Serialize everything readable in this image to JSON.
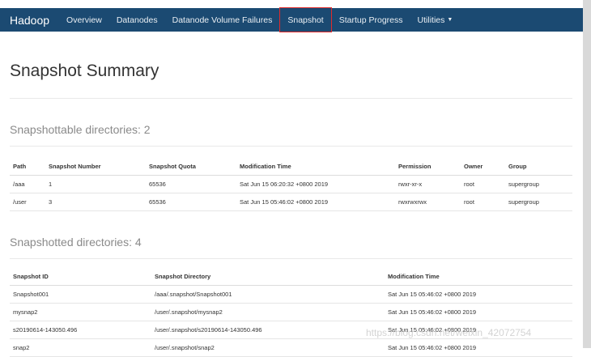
{
  "navbar": {
    "brand": "Hadoop",
    "items": [
      {
        "label": "Overview"
      },
      {
        "label": "Datanodes"
      },
      {
        "label": "Datanode Volume Failures"
      },
      {
        "label": "Snapshot"
      },
      {
        "label": "Startup Progress"
      },
      {
        "label": "Utilities"
      }
    ],
    "active": "Snapshot"
  },
  "page_title": "Snapshot Summary",
  "snapshottable": {
    "heading": "Snapshottable directories: 2",
    "columns": [
      "Path",
      "Snapshot Number",
      "Snapshot Quota",
      "Modification Time",
      "Permission",
      "Owner",
      "Group"
    ],
    "rows": [
      [
        "/aaa",
        "1",
        "65536",
        "Sat Jun 15 06:20:32 +0800 2019",
        "rwxr-xr-x",
        "root",
        "supergroup"
      ],
      [
        "/user",
        "3",
        "65536",
        "Sat Jun 15 05:46:02 +0800 2019",
        "rwxrwxrwx",
        "root",
        "supergroup"
      ]
    ]
  },
  "snapshotted": {
    "heading": "Snapshotted directories: 4",
    "columns": [
      "Snapshot ID",
      "Snapshot Directory",
      "Modification Time"
    ],
    "rows": [
      [
        "Snapshot001",
        "/aaa/.snapshot/Snapshot001",
        "Sat Jun 15 05:46:02 +0800 2019"
      ],
      [
        "mysnap2",
        "/user/.snapshot/mysnap2",
        "Sat Jun 15 05:46:02 +0800 2019"
      ],
      [
        "s20190614-143050.496",
        "/user/.snapshot/s20190614-143050.496",
        "Sat Jun 15 05:46:02 +0800 2019"
      ],
      [
        "snap2",
        "/user/.snapshot/snap2",
        "Sat Jun 15 05:46:02 +0800 2019"
      ]
    ]
  },
  "watermark": "https://blog.csdn.net/weixin_42072754",
  "colors": {
    "navbar": "#1b4a72",
    "highlight": "#e12b2b"
  }
}
